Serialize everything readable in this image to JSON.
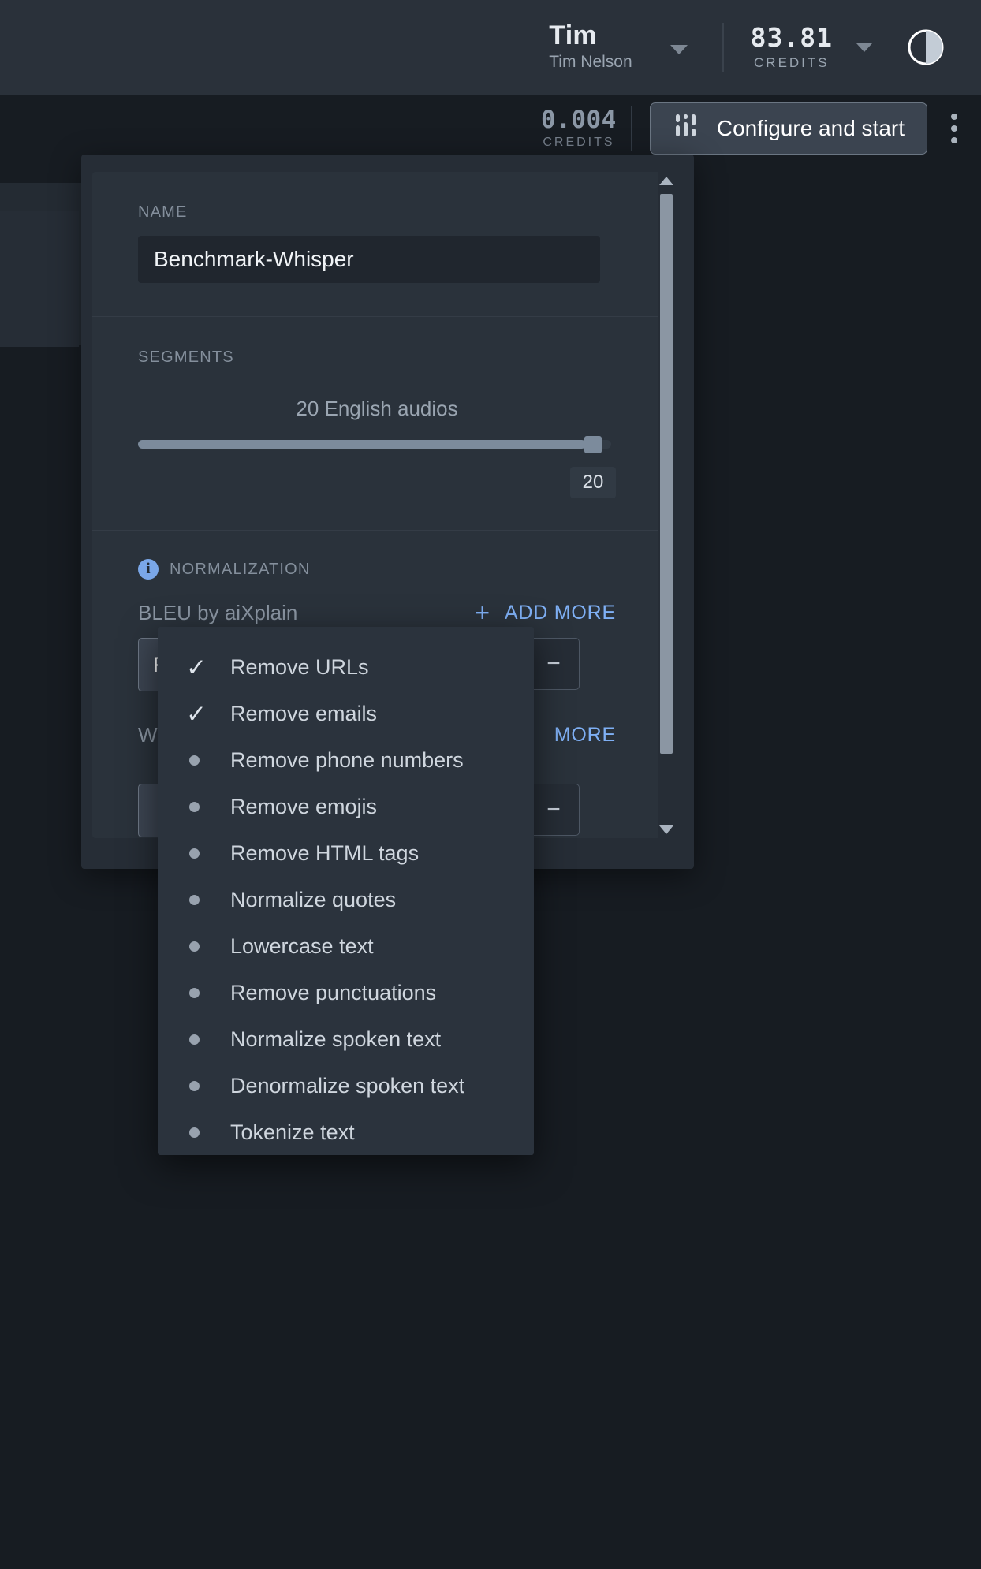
{
  "topbar": {
    "user_first_name": "Tim",
    "user_full_name": "Tim Nelson",
    "user_caret_icon": "chevron-down-icon",
    "credits_amount": "83.81",
    "credits_label": "CREDITS",
    "credits_caret_icon": "chevron-down-icon",
    "theme_toggle_icon": "contrast-half-circle-icon"
  },
  "actionbar": {
    "cost_amount": "0.004",
    "cost_label": "CREDITS",
    "configure_button_label": "Configure and start",
    "configure_button_icon": "sliders-icon",
    "kebab_icon": "more-vertical-icon"
  },
  "modal": {
    "name": {
      "label": "NAME",
      "value": "Benchmark-Whisper",
      "placeholder": "Name"
    },
    "segments": {
      "label": "SEGMENTS",
      "summary": "20 English audios",
      "value": "20",
      "slider_percent": 94
    },
    "normalization": {
      "info_icon": "info-icon",
      "label": "NORMALIZATION",
      "metric_label": "BLEU by aiXplain",
      "add_more_label": "ADD MORE",
      "add_more_icon": "plus-icon",
      "selected_value": "Remove URLs, Remove emails",
      "select_caret_icon": "chevron-down-icon",
      "remove_button_label": "−",
      "second_metric_label": "W",
      "second_add_more_label": "MORE",
      "second_remove_button_label": "−"
    },
    "footer": {
      "launch_icon": "rocket-icon",
      "launch_label": ""
    },
    "scrollbar": {
      "up_arrow_icon": "triangle-up-icon",
      "down_arrow_icon": "triangle-down-icon"
    }
  },
  "dropdown": {
    "items": [
      {
        "label": "Remove URLs",
        "selected": true
      },
      {
        "label": "Remove emails",
        "selected": true
      },
      {
        "label": "Remove phone numbers",
        "selected": false
      },
      {
        "label": "Remove emojis",
        "selected": false
      },
      {
        "label": "Remove HTML tags",
        "selected": false
      },
      {
        "label": "Normalize quotes",
        "selected": false
      },
      {
        "label": "Lowercase text",
        "selected": false
      },
      {
        "label": "Remove punctuations",
        "selected": false
      },
      {
        "label": "Normalize spoken text",
        "selected": false
      },
      {
        "label": "Denormalize spoken text",
        "selected": false
      },
      {
        "label": "Tokenize text",
        "selected": false
      }
    ]
  },
  "colors": {
    "accent_blue": "#7fb0f5",
    "topbar_bg": "#2a313a",
    "page_bg": "#171c22",
    "modal_bg": "#262d36",
    "panel_bg": "#2a323b",
    "slider_fill": "#7c8b9c"
  }
}
